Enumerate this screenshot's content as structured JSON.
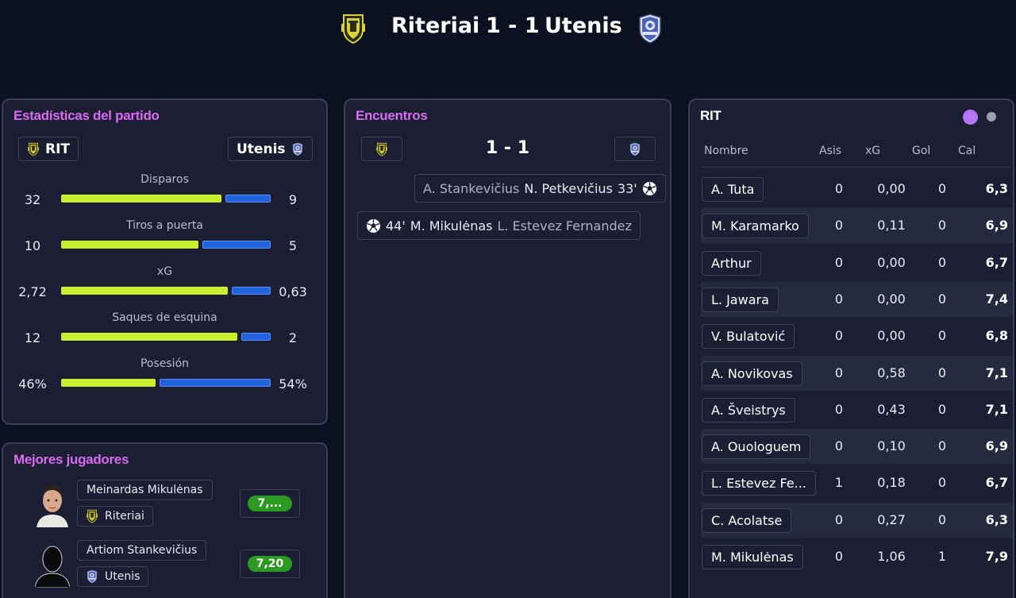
{
  "header": {
    "home_team": "Riteriai",
    "score": "1 - 1",
    "away_team": "Utenis"
  },
  "colors": {
    "accent_title": "#d96bf0",
    "home_bar": "#c8ef2e",
    "away_bar": "#1f63e0",
    "rating_good": "#2b9a23",
    "toggle_active": "#b577f5",
    "toggle_inactive": "#9aa0b0"
  },
  "stats": {
    "title": "Estadísticas del partido",
    "home_chip": "RIT",
    "away_chip": "Utenis",
    "rows": [
      {
        "label": "Disparos",
        "home": "32",
        "away": "9",
        "home_share": 0.78
      },
      {
        "label": "Tiros a puerta",
        "home": "10",
        "away": "5",
        "home_share": 0.667
      },
      {
        "label": "xG",
        "home": "2,72",
        "away": "0,63",
        "home_share": 0.81
      },
      {
        "label": "Saques de esquina",
        "home": "12",
        "away": "2",
        "home_share": 0.857
      },
      {
        "label": "Posesión",
        "home": "46%",
        "away": "54%",
        "home_share": 0.46
      }
    ]
  },
  "best_players": {
    "title": "Mejores jugadores",
    "players": [
      {
        "name": "Meinardas Mikulėnas",
        "team": "Riteriai",
        "rating": "7,..."
      },
      {
        "name": "Artiom Stankevičius",
        "team": "Utenis",
        "rating": "7,20"
      }
    ]
  },
  "encounters": {
    "title": "Encuentros",
    "score": "1 - 1",
    "events": [
      {
        "side": "away",
        "assist": "A. Stankevičius",
        "scorer": "N. Petkevičius",
        "minute": "33'",
        "icon": "soccer-ball-icon"
      },
      {
        "side": "home",
        "assist": "L. Estevez Fernandez",
        "scorer": "M. Mikulėnas",
        "minute": "44'",
        "icon": "soccer-ball-icon"
      }
    ]
  },
  "player_table": {
    "title": "RIT",
    "columns": {
      "name": "Nombre",
      "assists": "Asis",
      "xg": "xG",
      "goals": "Gol",
      "rating": "Cal"
    },
    "rows": [
      {
        "name": "A. Tuta",
        "assists": "0",
        "xg": "0,00",
        "goals": "0",
        "rating": "6,3"
      },
      {
        "name": "M. Karamarko",
        "assists": "0",
        "xg": "0,11",
        "goals": "0",
        "rating": "6,9"
      },
      {
        "name": "Arthur",
        "assists": "0",
        "xg": "0,00",
        "goals": "0",
        "rating": "6,7"
      },
      {
        "name": "L. Jawara",
        "assists": "0",
        "xg": "0,00",
        "goals": "0",
        "rating": "7,4"
      },
      {
        "name": "V. Bulatović",
        "assists": "0",
        "xg": "0,00",
        "goals": "0",
        "rating": "6,8"
      },
      {
        "name": "A. Novikovas",
        "assists": "0",
        "xg": "0,58",
        "goals": "0",
        "rating": "7,1"
      },
      {
        "name": "A. Šveistrys",
        "assists": "0",
        "xg": "0,43",
        "goals": "0",
        "rating": "7,1"
      },
      {
        "name": "A. Ouologuem",
        "assists": "0",
        "xg": "0,10",
        "goals": "0",
        "rating": "6,9"
      },
      {
        "name": "L. Estevez Fe...",
        "assists": "1",
        "xg": "0,18",
        "goals": "0",
        "rating": "6,7"
      },
      {
        "name": "C. Acolatse",
        "assists": "0",
        "xg": "0,27",
        "goals": "0",
        "rating": "6,3"
      },
      {
        "name": "M. Mikulėnas",
        "assists": "0",
        "xg": "1,06",
        "goals": "1",
        "rating": "7,9"
      }
    ]
  }
}
